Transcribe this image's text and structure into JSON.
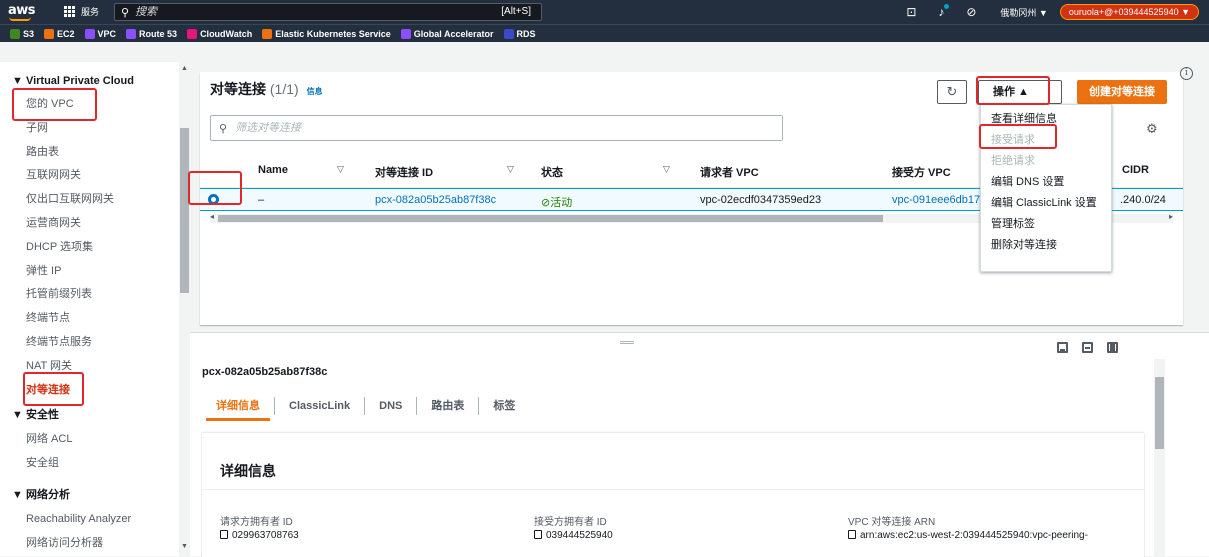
{
  "topbar": {
    "logo": "aws",
    "services_label": "服务",
    "search_placeholder": "搜索",
    "search_shortcut": "[Alt+S]",
    "region": "俄勒冈州 ▼",
    "account": "ouruola+@+039444525940 ▼",
    "favorites": [
      {
        "label": "S3",
        "color": "#3f8624"
      },
      {
        "label": "EC2",
        "color": "#ec7211"
      },
      {
        "label": "VPC",
        "color": "#8c4fff"
      },
      {
        "label": "Route 53",
        "color": "#8c4fff"
      },
      {
        "label": "CloudWatch",
        "color": "#e7157b"
      },
      {
        "label": "Elastic Kubernetes Service",
        "color": "#ec7211"
      },
      {
        "label": "Global Accelerator",
        "color": "#8c4fff"
      },
      {
        "label": "RDS",
        "color": "#3b48cc"
      }
    ]
  },
  "sidebar": {
    "head": "▼ Virtual Private Cloud",
    "items": [
      "您的 VPC",
      "子网",
      "路由表",
      "互联网网关",
      "仅出口互联网网关",
      "运营商网关",
      "DHCP 选项集",
      "弹性 IP",
      "托管前缀列表",
      "终端节点",
      "终端节点服务",
      "NAT 网关",
      "对等连接"
    ],
    "section_security": "▼ 安全性",
    "security_items": [
      "网络 ACL",
      "安全组"
    ],
    "section_network": "▼ 网络分析",
    "network_items": [
      "Reachability Analyzer",
      "网络访问分析器"
    ]
  },
  "panel": {
    "title": "对等连接",
    "count": "(1/1)",
    "info": "信息",
    "refresh_icon": "↻",
    "actions_label": "操作 ▲",
    "create_label": "创建对等连接",
    "filter_placeholder": "筛选对等连接",
    "columns": {
      "name": "Name",
      "id": "对等连接 ID",
      "status": "状态",
      "requester_vpc": "请求者 VPC",
      "accepter_vpc": "接受方 VPC",
      "cidr": "CIDR"
    },
    "row": {
      "name": "–",
      "id": "pcx-082a05b25ab87f38c",
      "status": "⊘活动",
      "requester_vpc": "vpc-02ecdf0347359ed23",
      "accepter_vpc": "vpc-091eee6db179",
      "cidr": ".240.0/24"
    }
  },
  "actions_menu": [
    "查看详细信息",
    "接受请求",
    "拒绝请求",
    "编辑 DNS 设置",
    "编辑 ClassicLink 设置",
    "管理标签",
    "删除对等连接"
  ],
  "detail": {
    "id": "pcx-082a05b25ab87f38c",
    "tabs": [
      "详细信息",
      "ClassicLink",
      "DNS",
      "路由表",
      "标签"
    ],
    "card_title": "详细信息",
    "fields": [
      {
        "label": "请求方拥有者 ID",
        "value": "029963708763"
      },
      {
        "label": "接受方拥有者 ID",
        "value": "039444525940"
      },
      {
        "label": "VPC 对等连接 ARN",
        "value": "arn:aws:ec2:us-west-2:039444525940:vpc-peering-"
      }
    ]
  }
}
